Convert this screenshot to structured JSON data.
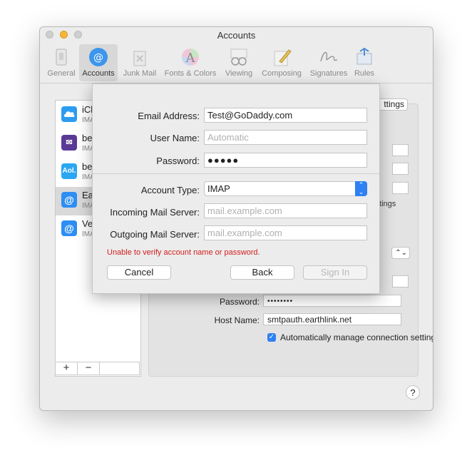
{
  "window": {
    "title": "Accounts"
  },
  "toolbar": {
    "items": [
      {
        "label": "General",
        "icon": "general-icon"
      },
      {
        "label": "Accounts",
        "icon": "accounts-icon"
      },
      {
        "label": "Junk Mail",
        "icon": "junk-mail-icon"
      },
      {
        "label": "Fonts & Colors",
        "icon": "fonts-colors-icon"
      },
      {
        "label": "Viewing",
        "icon": "viewing-icon"
      },
      {
        "label": "Composing",
        "icon": "composing-icon"
      },
      {
        "label": "Signatures",
        "icon": "signatures-icon"
      },
      {
        "label": "Rules",
        "icon": "rules-icon"
      }
    ]
  },
  "accounts": [
    {
      "name": "iCl",
      "type": "IMA",
      "icon": "icloud-icon",
      "icon_text": "",
      "color": "#2b9cf0"
    },
    {
      "name": "be",
      "type": "IMA",
      "icon": "mail-envelope-icon",
      "icon_text": "✉",
      "color": "#5b3a96"
    },
    {
      "name": "be",
      "type": "IMA",
      "icon": "aol-icon",
      "icon_text": "Aol.",
      "color": "#2aa7f2"
    },
    {
      "name": "Ea",
      "type": "IMA",
      "icon": "at-sign-icon",
      "icon_text": "@",
      "color": "#2d8ef3"
    },
    {
      "name": "Ve",
      "type": "IMA",
      "icon": "at-sign-icon",
      "icon_text": "@",
      "color": "#2d8ef3"
    }
  ],
  "list_footer": {
    "add": "+",
    "remove": "−"
  },
  "panel": {
    "settings_button": "ttings",
    "settings_note": "ttings",
    "password_label": "Password:",
    "password_value": "••••••••",
    "host_label": "Host Name:",
    "host_value": "smtpauth.earthlink.net",
    "auto_manage_label": "Automatically manage connection settings"
  },
  "sheet": {
    "email_label": "Email Address:",
    "email_value": "Test@GoDaddy.com",
    "username_label": "User Name:",
    "username_placeholder": "Automatic",
    "password_label": "Password:",
    "password_value": "●●●●●",
    "account_type_label": "Account Type:",
    "account_type_value": "IMAP",
    "incoming_label": "Incoming Mail Server:",
    "incoming_placeholder": "mail.example.com",
    "outgoing_label": "Outgoing Mail Server:",
    "outgoing_placeholder": "mail.example.com",
    "error": "Unable to verify account name or password.",
    "cancel": "Cancel",
    "back": "Back",
    "sign_in": "Sign In"
  },
  "help": "?"
}
